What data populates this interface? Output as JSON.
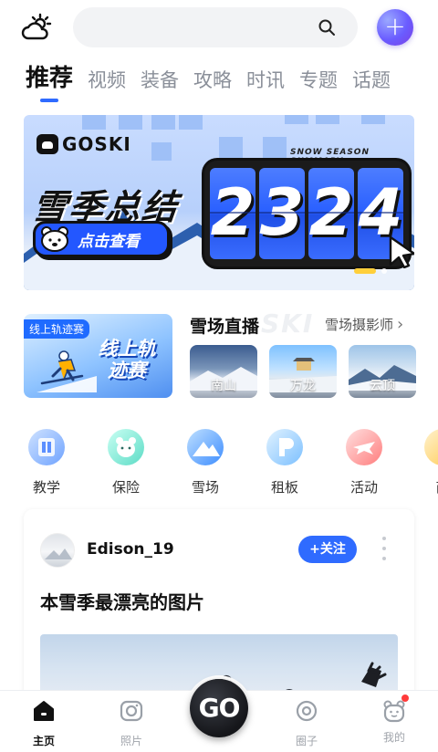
{
  "header": {
    "search_placeholder": "",
    "add_symbol": "+"
  },
  "tabs": [
    {
      "label": "推荐",
      "active": true
    },
    {
      "label": "视频"
    },
    {
      "label": "装备"
    },
    {
      "label": "攻略"
    },
    {
      "label": "时讯"
    },
    {
      "label": "专题"
    },
    {
      "label": "话题"
    }
  ],
  "banner": {
    "brand": "GOSKI",
    "tag": "SNOW SEASON SUMMARY",
    "title": "雪季总结",
    "cta": "点击查看",
    "digits": [
      "2",
      "3",
      "2",
      "4"
    ],
    "page_indicator": {
      "current": 1,
      "total": 2
    }
  },
  "promo": {
    "tag": "线上轨迹赛",
    "title": "线上轨迹赛"
  },
  "live": {
    "title": "雪场直播",
    "watermark": "SKI",
    "more_label": "雪场摄影师",
    "more_chevron": "›",
    "cams": [
      {
        "label": "南山"
      },
      {
        "label": "万龙"
      },
      {
        "label": "云顶"
      }
    ]
  },
  "categories": [
    {
      "label": "教学",
      "icon": "teaching-icon",
      "color": "#7fb2ff"
    },
    {
      "label": "保险",
      "icon": "insurance-bear-icon",
      "color": "#6fe0d0"
    },
    {
      "label": "雪场",
      "icon": "ski-resort-icon",
      "color": "#5aa9ff"
    },
    {
      "label": "租板",
      "icon": "board-rental-icon",
      "color": "#8ecbff"
    },
    {
      "label": "活动",
      "icon": "activity-plane-icon",
      "color": "#ff8a8a"
    },
    {
      "label": "商",
      "icon": "more-category-icon",
      "color": "#ffd36a"
    }
  ],
  "post": {
    "username": "Edison_19",
    "follow_label": "+关注",
    "title": "本雪季最漂亮的图片"
  },
  "bottom_nav": {
    "items": [
      {
        "label": "主页",
        "icon": "home-icon",
        "active": true
      },
      {
        "label": "照片",
        "icon": "photo-icon"
      },
      {
        "label": "圈子",
        "icon": "circle-icon"
      },
      {
        "label": "我的",
        "icon": "profile-bear-icon",
        "badge": true
      }
    ],
    "go_label": "GO"
  },
  "colors": {
    "accent": "#2f6bff",
    "tab_indicator": "#2f6bff",
    "badge": "#ff3b3b",
    "page_dot": "#ffcf3a"
  }
}
